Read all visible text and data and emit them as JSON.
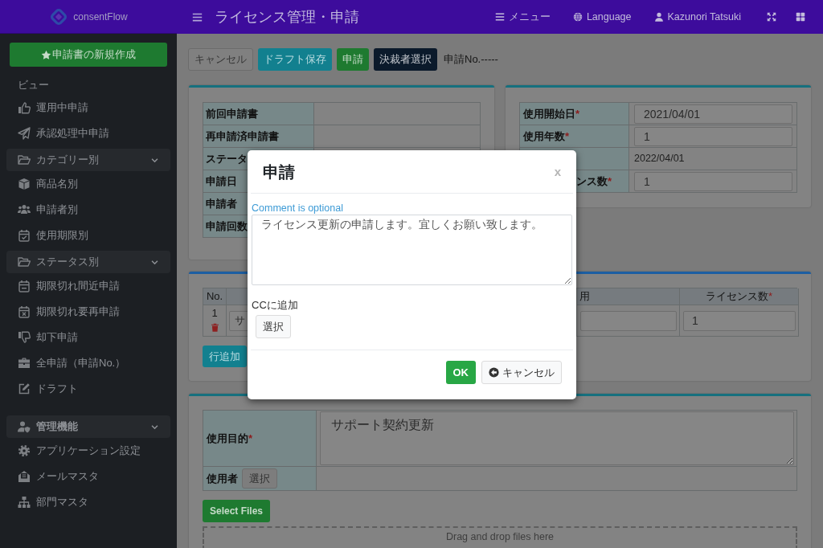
{
  "app": {
    "brand": "consentFlow",
    "page_title": "ライセンス管理・申請"
  },
  "top_nav": [
    {
      "kind": "menu",
      "label": "メニュー"
    },
    {
      "kind": "language",
      "label": "Language"
    },
    {
      "kind": "user",
      "label": "Kazunori Tatsuki"
    },
    {
      "kind": "fullscreen"
    },
    {
      "kind": "layout"
    }
  ],
  "sidebar": {
    "new_button": "申請書の新規作成",
    "items": [
      {
        "kind": "header",
        "label": "ビュー"
      },
      {
        "kind": "item",
        "label": "運用中申請"
      },
      {
        "kind": "item",
        "label": "承認処理中申請"
      },
      {
        "kind": "group",
        "label": "カテゴリー別",
        "expanded": true,
        "children": [
          {
            "label": "商品名別"
          },
          {
            "label": "申請者別"
          },
          {
            "label": "使用期限別"
          }
        ]
      },
      {
        "kind": "group",
        "label": "ステータス別",
        "expanded": true,
        "children": [
          {
            "label": "期限切れ間近申請"
          },
          {
            "label": "期限切れ要再申請"
          },
          {
            "label": "却下申請"
          },
          {
            "label": "全申請（申請No.）"
          },
          {
            "label": "ドラフト"
          }
        ]
      },
      {
        "kind": "section",
        "label": "管理機能",
        "expanded": true,
        "children": [
          {
            "label": "アプリケーション設定"
          },
          {
            "label": "メールマスタ"
          },
          {
            "label": "部門マスタ"
          }
        ]
      }
    ]
  },
  "toolbar": {
    "buttons": [
      {
        "kind": "default",
        "label": "キャンセル"
      },
      {
        "kind": "info",
        "label": "ドラフト保存"
      },
      {
        "kind": "success",
        "label": "申請"
      },
      {
        "kind": "dark",
        "label": "決裁者選択"
      }
    ],
    "application_no": "申請No.-----"
  },
  "history_table": {
    "rows": [
      {
        "label": "前回申請書"
      },
      {
        "label": "再申請済申請書"
      },
      {
        "label": "ステータ"
      },
      {
        "label": "申請日"
      },
      {
        "label": "申請者"
      },
      {
        "label": "申請回数"
      }
    ]
  },
  "period_table": {
    "rows": [
      {
        "kind": "input",
        "label": "使用開始日",
        "required_mark": "*",
        "label_cut": false,
        "value": "2021/04/01"
      },
      {
        "kind": "input",
        "label": "使用年数",
        "required_mark": "*",
        "label_cut": false,
        "value": "1"
      },
      {
        "kind": "text",
        "value": "2022/04/01"
      },
      {
        "kind": "input",
        "label": "ンス数",
        "required_mark": "*",
        "label_cut": true,
        "value": "1"
      }
    ]
  },
  "items_table": {
    "columns": [
      {
        "label": "No."
      },
      {
        "label": "用"
      },
      {
        "label": "ライセンス数",
        "required_mark": "*"
      }
    ],
    "rows": [
      {
        "no": "1",
        "product": "サ",
        "licenses": "1"
      }
    ],
    "add_row_button": "行追加"
  },
  "purpose_table": {
    "purpose_label": "使用目的",
    "purpose_required_mark": "*",
    "purpose": "サポート契約更新",
    "user_label": "使用者",
    "user_button": "選択"
  },
  "attachments": {
    "button": "Select Files",
    "drop_hint": "Drag and drop files here"
  },
  "dialog": {
    "title": "申請",
    "close": "x",
    "comment_label": "Comment is optional",
    "comment": "ライセンス更新の申請します。宜しくお願い致します。",
    "cc_label": "CCに追加",
    "cc_button": "選択",
    "ok": "OK",
    "cancel": "キャンセル"
  }
}
